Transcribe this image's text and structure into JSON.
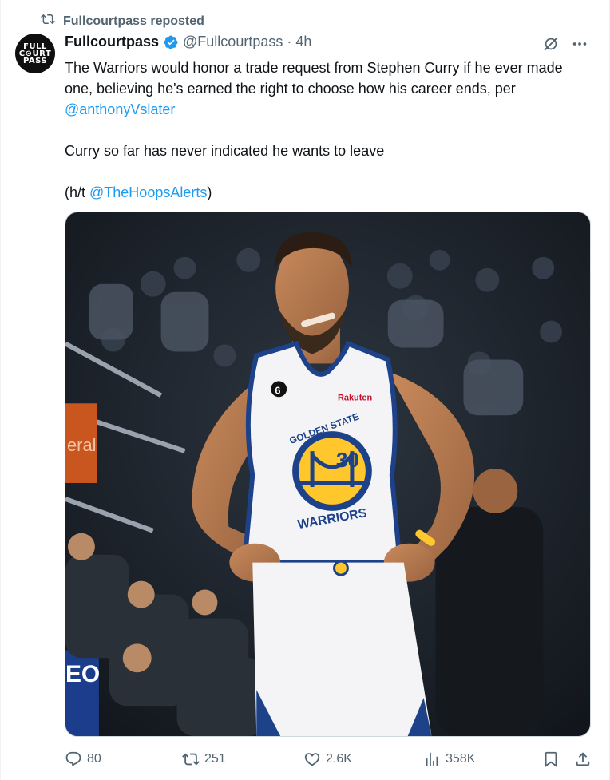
{
  "repost": {
    "label": "Fullcourtpass reposted",
    "icon": "repost-icon"
  },
  "author": {
    "avatar_text": "FULL COURT PASS",
    "name": "Fullcourtpass",
    "verified": true,
    "handle": "@Fullcourtpass",
    "separator": "·",
    "time": "4h"
  },
  "tweet": {
    "line1": "The Warriors would honor a trade request from Stephen Curry if he ever made one, believing he's earned the right to choose how his career ends, per ",
    "mention1": "@anthonyVslater",
    "line2": "Curry so far has never indicated he wants to leave",
    "ht_open": "(h/t ",
    "mention2": "@TheHoopsAlerts",
    "ht_close": ")"
  },
  "image": {
    "jersey_number": "30",
    "jersey_sponsor": "Rakuten",
    "jersey_team_top": "GOLDEN STATE",
    "jersey_team_bottom": "WARRIORS",
    "patch_number": "6",
    "board_text": "EO",
    "board2_text": "eral"
  },
  "actions": {
    "replies": "80",
    "reposts": "251",
    "likes": "2.6K",
    "views": "358K"
  },
  "colors": {
    "accent": "#1d9bf0",
    "text_secondary": "#536471",
    "warriors_blue": "#1d428a",
    "warriors_gold": "#ffc72c"
  }
}
